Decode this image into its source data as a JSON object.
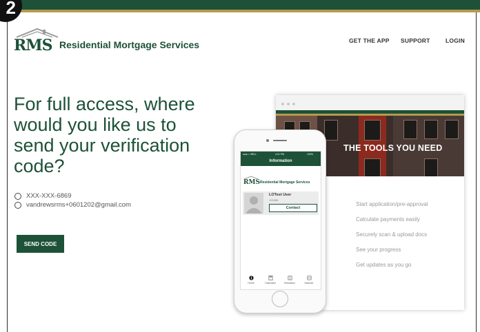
{
  "step_badge": "2",
  "colors": {
    "brand_green": "#1d5138",
    "brand_gold": "#b79a4c"
  },
  "logo": {
    "mark": "RMS",
    "name": "Residential Mortgage Services"
  },
  "nav": {
    "get_app": "GET THE APP",
    "support": "SUPPORT",
    "login": "LOGIN"
  },
  "main": {
    "heading": "For full access, where would you like us to send your verification code?",
    "options": [
      {
        "label": "XXX-XXX-6869",
        "selected": false
      },
      {
        "label": "vandrewsrms+0601202@gmail.com",
        "selected": false
      }
    ],
    "send_button": "SEND CODE"
  },
  "promo": {
    "hero_title": "THE TOOLS YOU NEED",
    "features": [
      "Start application/pre-approval",
      "Calculate payments easily",
      "Securely scan & upload docs",
      "See your progress",
      "Get updates as you go"
    ]
  },
  "phone": {
    "status": {
      "carrier": "●●●○○ BELL",
      "time": "4:21 PM",
      "battery": "100%"
    },
    "header": "Information",
    "logo_mark": "RMS",
    "logo_name": "Residential Mortgage Services",
    "user_name": "LOTest User",
    "user_id": "123456",
    "contact_button": "Contact",
    "tabs": [
      "Home",
      "Calculator",
      "Education",
      "Scanner"
    ]
  }
}
